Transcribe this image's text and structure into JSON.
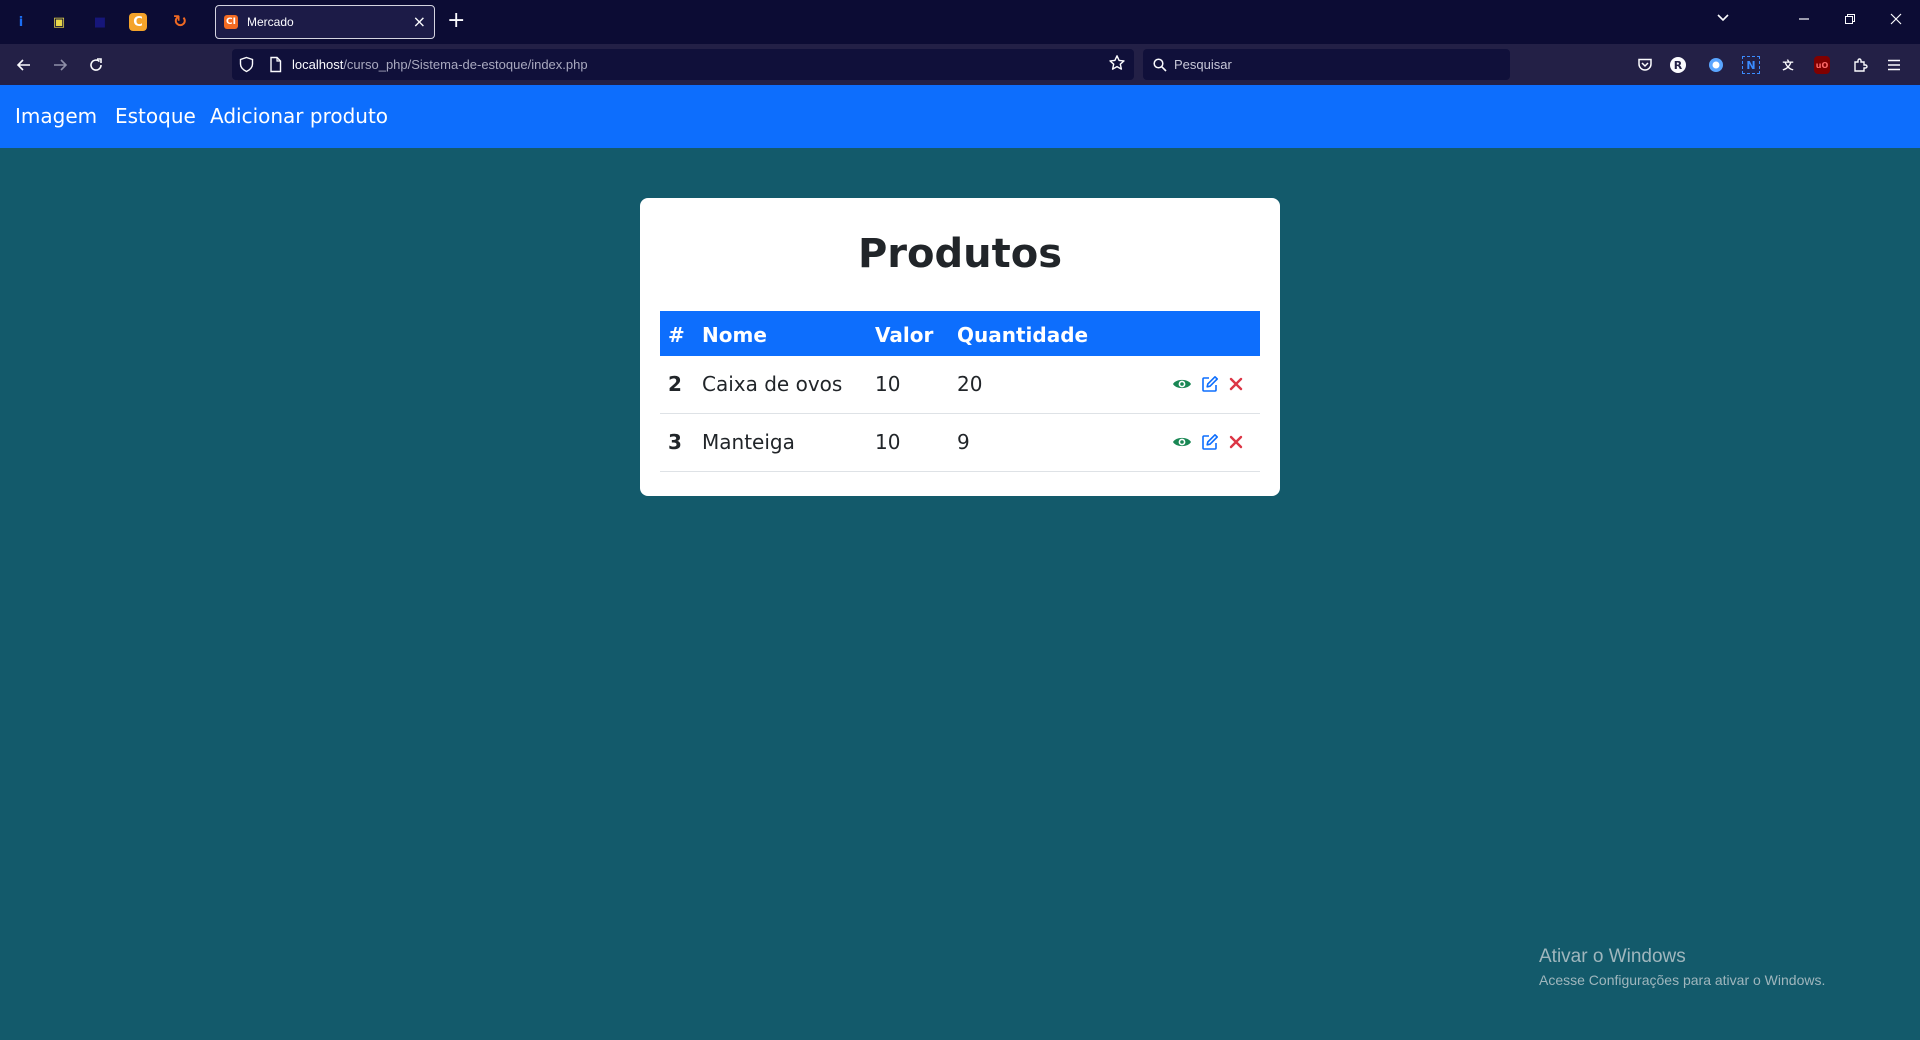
{
  "browser": {
    "pinned_tabs": [
      {
        "name": "pinned-tab-1",
        "glyph": "i",
        "color": "#1b6ef3"
      },
      {
        "name": "pinned-tab-2",
        "glyph": "▣",
        "color": "#e9d84b"
      },
      {
        "name": "pinned-tab-3",
        "glyph": "■",
        "color": "#16167a"
      },
      {
        "name": "pinned-tab-4",
        "glyph": "C",
        "color": "#f4a32a"
      },
      {
        "name": "pinned-tab-5",
        "glyph": "↻",
        "color": "#f06a23"
      }
    ],
    "tab": {
      "title": "Mercado",
      "favicon": "CI",
      "close": "×"
    },
    "new_tab": "+",
    "url": {
      "host": "localhost",
      "path": "/curso_php/Sistema-de-estoque/index.php"
    },
    "search": {
      "placeholder": "Pesquisar"
    },
    "extensions": [
      {
        "name": "pocket-icon"
      },
      {
        "name": "extension-r-icon",
        "glyph": "R"
      },
      {
        "name": "extension-globe-icon"
      },
      {
        "name": "extension-n-icon",
        "glyph": "N"
      },
      {
        "name": "extension-translate-icon",
        "glyph": "文"
      },
      {
        "name": "ublock-icon",
        "glyph": "uO"
      },
      {
        "name": "extensions-puzzle-icon"
      },
      {
        "name": "menu-icon"
      }
    ]
  },
  "site": {
    "nav": {
      "logo": "Imagem",
      "links": [
        "Estoque",
        "Adicionar produto"
      ]
    },
    "title": "Produtos",
    "table": {
      "headers": [
        "#",
        "Nome",
        "Valor",
        "Quantidade"
      ],
      "rows": [
        {
          "id": "2",
          "nome": "Caixa de ovos",
          "valor": "10",
          "quantidade": "20"
        },
        {
          "id": "3",
          "nome": "Manteiga",
          "valor": "10",
          "quantidade": "9"
        }
      ]
    },
    "colors": {
      "primary": "#0d6efd",
      "view": "#198754",
      "edit": "#0d6efd",
      "delete": "#dc3545",
      "background": "#135a6b"
    }
  },
  "watermark": {
    "title": "Ativar o Windows",
    "subtitle": "Acesse Configurações para ativar o Windows."
  }
}
